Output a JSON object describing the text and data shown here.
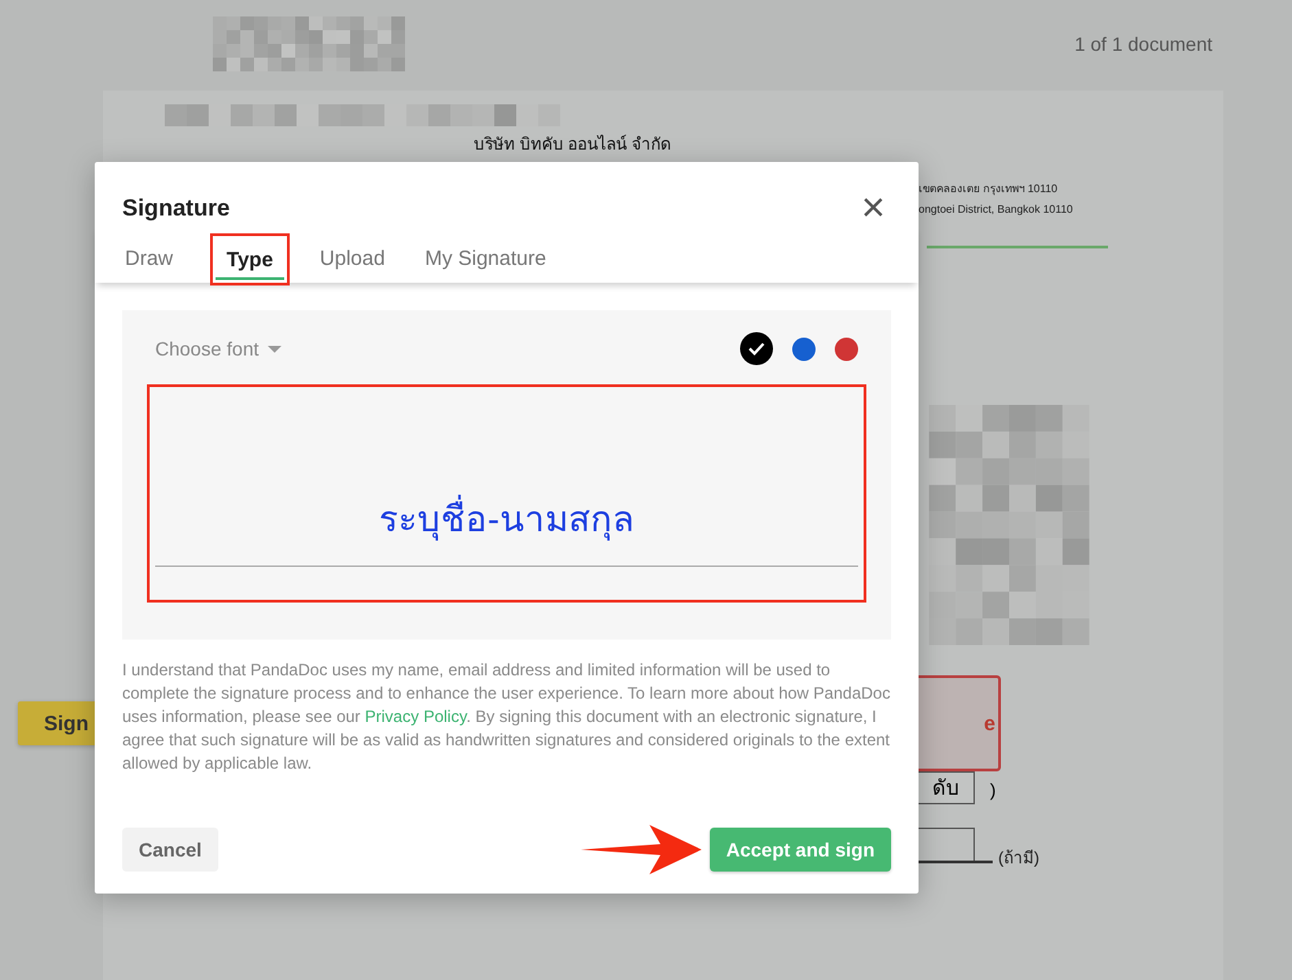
{
  "document": {
    "counter": "1 of 1 document",
    "company_th": "บริษัท บิทคับ ออนไลน์ จำกัด",
    "address_lines": [
      "เขตคลองเตย กรุงเทพฯ 10110",
      "ongtoei District, Bangkok 10110"
    ],
    "signature_field_fragment": "e",
    "field_fragment": "ดับ",
    "paren": ")",
    "optional_note": "(ถ้ามี)",
    "sign_button": "Sign"
  },
  "dialog": {
    "title": "Signature",
    "close": "×",
    "tabs": [
      {
        "label": "Draw",
        "selected": false,
        "highlighted": false
      },
      {
        "label": "Type",
        "selected": true,
        "highlighted": true
      },
      {
        "label": "Upload",
        "selected": false,
        "highlighted": false
      },
      {
        "label": "My Signature",
        "selected": false,
        "highlighted": false
      }
    ],
    "font_picker": "Choose font",
    "colors": [
      {
        "color": "#000000",
        "selected": true
      },
      {
        "color": "#1660d0",
        "selected": false
      },
      {
        "color": "#d03535",
        "selected": false
      }
    ],
    "signature_input": {
      "value": "ระบุชื่อ-นามสกุล",
      "highlighted": true
    },
    "consent_before": "I understand that PandaDoc uses my name, email address and limited information will be used to complete the signature process and to enhance the user experience. To learn more about how PandaDoc uses information, please see our ",
    "consent_link": "Privacy Policy",
    "consent_after": ". By signing this document with an electronic signature, I agree that such signature will be as valid as handwritten signatures and considered originals to the extent allowed by applicable law.",
    "buttons": [
      {
        "kind": "secondary",
        "label": "Cancel",
        "arrow": false
      },
      {
        "kind": "primary",
        "label": "Accept and sign",
        "arrow": true
      }
    ]
  }
}
